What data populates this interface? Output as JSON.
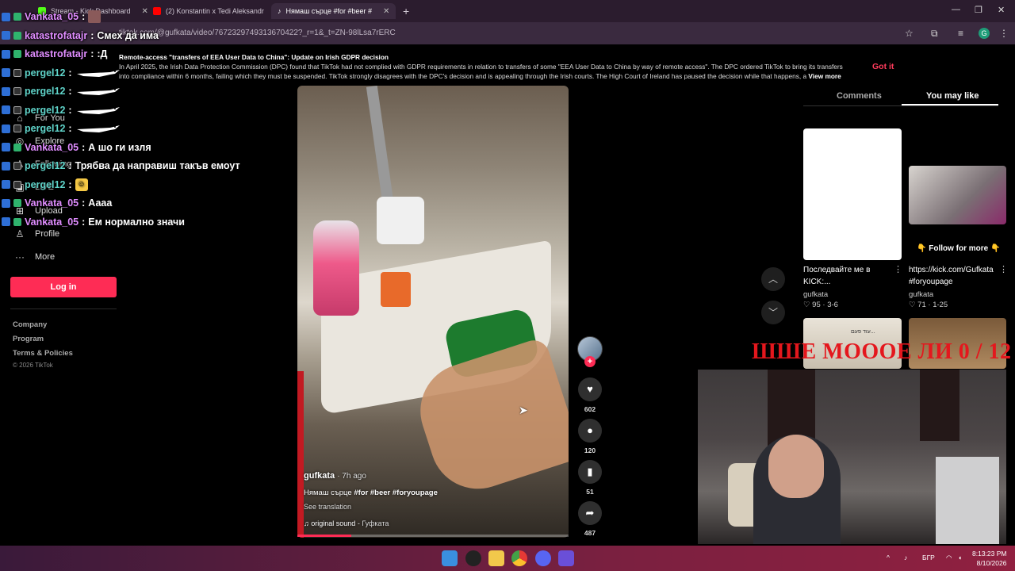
{
  "browser": {
    "tabs": [
      {
        "label": "Stream - Kick Dashboard"
      },
      {
        "label": "(2) Konstantin x Tedi Aleksandr"
      },
      {
        "label": "Нямаш сърце #for #beer #"
      }
    ],
    "new_tab": "+",
    "url": "tiktok.com/@gufkata/video/7672329749313670422?_r=1&_t=ZN-98lLsa7rERC",
    "profile_initial": "G"
  },
  "banner": {
    "title_prefix": "Remote-access \"transfers of EEA User Data to China\": Update",
    "title_bold": "on Irish GDPR decision",
    "line1": "In April 2025, the Irish Data Protection Commission (DPC) found that TikTok had not complied with GDPR requirements in relation to transfers of some \"EEA User Data to China by way of remote access\". The DPC ordered TikTok to bring its transfers",
    "line2": "into compliance within 6 months, failing which they must be suspended. TikTok strongly disagrees with the DPC's decision and is appealing through the Irish courts. The High Court of Ireland has paused the decision while that happens, a",
    "view_more": "View more",
    "got_it": "Got it"
  },
  "nav": {
    "items": [
      {
        "label": "For You",
        "icon": "home-icon"
      },
      {
        "label": "Explore",
        "icon": "compass-icon"
      },
      {
        "label": "Following",
        "icon": "following-icon"
      },
      {
        "label": "LIVE",
        "icon": "live-icon"
      },
      {
        "label": "Upload",
        "icon": "upload-icon"
      },
      {
        "label": "Profile",
        "icon": "profile-icon"
      },
      {
        "label": "More",
        "icon": "more-icon"
      }
    ],
    "login": "Log in",
    "footer": [
      "Company",
      "Program",
      "Terms & Policies"
    ],
    "copyright": "© 2026 TikTok"
  },
  "chat": [
    {
      "user": "Vankata_05",
      "sep": ":",
      "msg": "",
      "user_color": "pink",
      "emote": "badge"
    },
    {
      "user": "katastrofatajr",
      "sep": ":",
      "msg": "Смех да има",
      "user_color": "pink",
      "emote": ""
    },
    {
      "user": "katastrofatajr",
      "sep": ":",
      "msg": ":Д",
      "user_color": "pink",
      "emote": ""
    },
    {
      "user": "pergel12",
      "sep": ":",
      "msg": "",
      "user_color": "teal",
      "emote": "goose"
    },
    {
      "user": "pergel12",
      "sep": ":",
      "msg": "",
      "user_color": "teal",
      "emote": "goose"
    },
    {
      "user": "pergel12",
      "sep": ":",
      "msg": "",
      "user_color": "teal",
      "emote": "goose"
    },
    {
      "user": "pergel12",
      "sep": ":",
      "msg": "",
      "user_color": "teal",
      "emote": "goose"
    },
    {
      "user": "Vankata_05",
      "sep": ":",
      "msg": "А шо ги изля",
      "user_color": "pink",
      "emote": ""
    },
    {
      "user": "pergel12",
      "sep": ":",
      "msg": "Трябва да направиш такъв емоут",
      "user_color": "teal",
      "emote": ""
    },
    {
      "user": "pergel12",
      "sep": ":",
      "msg": "",
      "user_color": "teal",
      "emote": "face"
    },
    {
      "user": "Vankata_05",
      "sep": ":",
      "msg": "Аааа",
      "user_color": "pink",
      "emote": ""
    },
    {
      "user": "Vankata_05",
      "sep": ":",
      "msg": "Ем нормално значи",
      "user_color": "pink",
      "emote": ""
    }
  ],
  "video": {
    "author": "gufkata",
    "time": "· 7h ago",
    "caption": "Нямаш сърце",
    "tags": "#for #beer #foryoupage",
    "see_translation": "See translation",
    "sound_label": "original sound",
    "sound_author": "- Гуфката",
    "progress": 0.2
  },
  "actions": {
    "likes": "602",
    "comments": "120",
    "saves": "51",
    "shares": "487"
  },
  "right_panel": {
    "tabs": [
      "Comments",
      "You may like"
    ],
    "active_tab": "You may like",
    "cards": [
      {
        "title": "Последвайте ме в KICK:...",
        "author": "gufkata",
        "likes": "95",
        "date": "3-6"
      },
      {
        "title": "https://kick.com/Gufkata #foryoupage",
        "overlay": "👇 Follow for more 👇",
        "author": "gufkata",
        "likes": "71",
        "date": "1-25"
      }
    ],
    "thumb3_text": "עוד פעם..."
  },
  "webcam": {
    "title": "ШШЕ МОООЕ ЛИ 0 / 12"
  },
  "taskbar": {
    "lang": "БГР",
    "time": "8:13:23 PM",
    "date": "8/10/2026"
  }
}
